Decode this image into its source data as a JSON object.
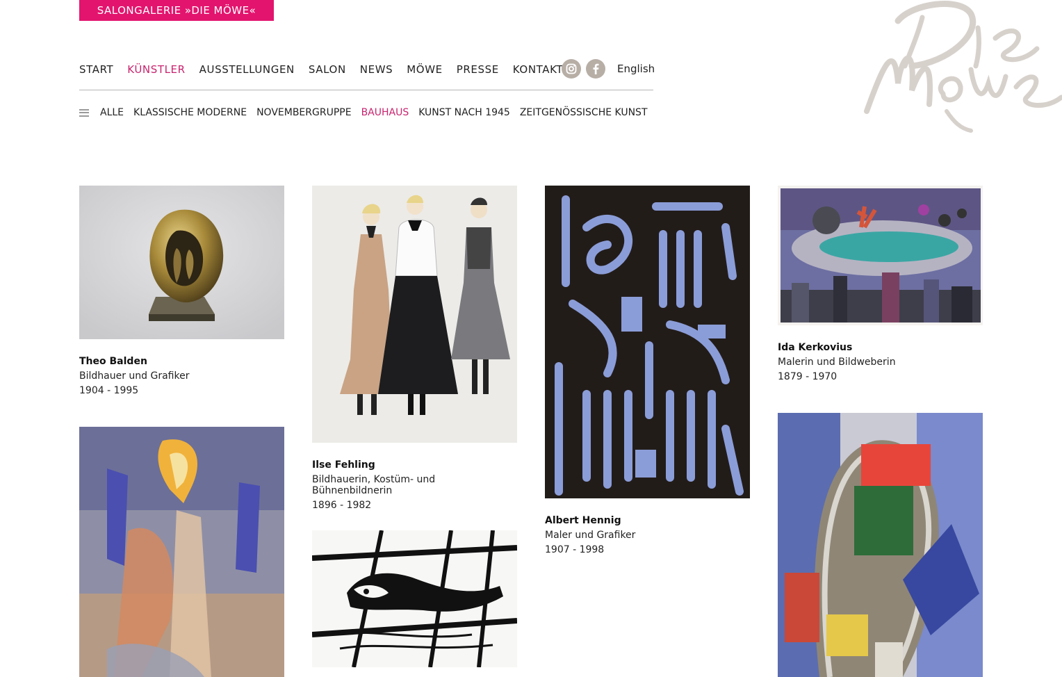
{
  "brand": {
    "label": "SALONGALERIE »DIE MÖWE«"
  },
  "logo": {
    "text_line1": "Die",
    "text_line2": "Möwe",
    "color": "#d7d1cc"
  },
  "nav": {
    "items": [
      {
        "label": "START"
      },
      {
        "label": "KÜNSTLER",
        "active": true
      },
      {
        "label": "AUSSTELLUNGEN"
      },
      {
        "label": "SALON"
      },
      {
        "label": "NEWS"
      },
      {
        "label": "MÖWE"
      },
      {
        "label": "PRESSE"
      },
      {
        "label": "KONTAKT"
      }
    ],
    "social": [
      {
        "icon": "instagram-icon"
      },
      {
        "icon": "facebook-icon"
      }
    ],
    "language": "English"
  },
  "subnav": {
    "items": [
      {
        "label": "ALLE"
      },
      {
        "label": "KLASSISCHE MODERNE"
      },
      {
        "label": "NOVEMBERGRUPPE"
      },
      {
        "label": "BAUHAUS",
        "active": true
      },
      {
        "label": "KUNST NACH 1945"
      },
      {
        "label": "ZEITGENÖSSISCHE KUNST"
      }
    ]
  },
  "artists": [
    {
      "name": "Theo Balden",
      "role": "Bildhauer und Grafiker",
      "years": "1904 - 1995"
    },
    {
      "name": "Ilse Fehling",
      "role": "Bildhauerin, Kostüm- und Bühnenbildnerin",
      "years": "1896 - 1982"
    },
    {
      "name": "Albert Hennig",
      "role": "Maler und Grafiker",
      "years": "1907 - 1998"
    },
    {
      "name": "Ida Kerkovius",
      "role": "Malerin und Bildweberin",
      "years": "1879 - 1970"
    }
  ],
  "colors": {
    "accent": "#e3146e",
    "active_link": "#c8246e",
    "social": "#b7aea6"
  }
}
